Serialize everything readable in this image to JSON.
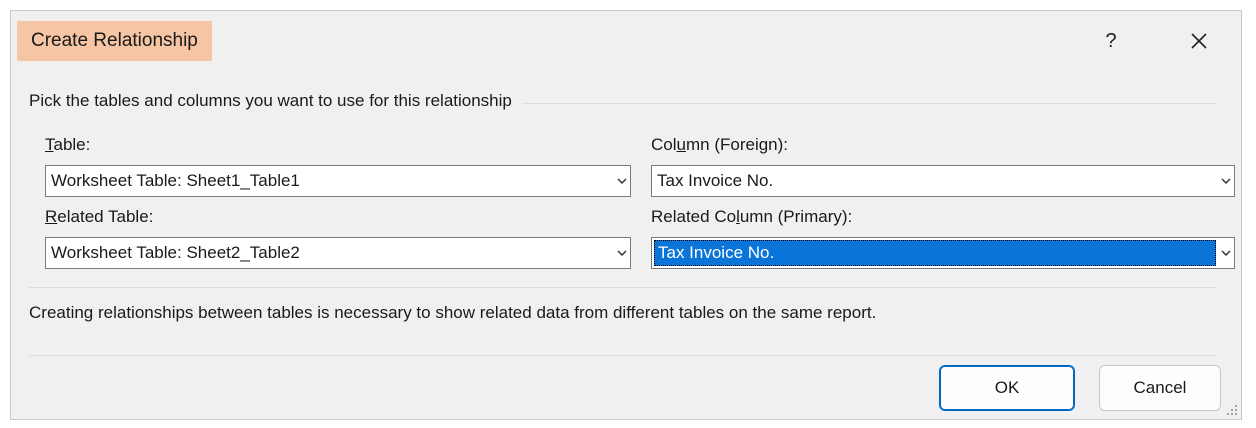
{
  "dialog": {
    "title": "Create Relationship",
    "help_label": "?",
    "close_icon": "close-icon"
  },
  "group": {
    "label": "Pick the tables and columns you want to use for this relationship"
  },
  "table": {
    "label_accel": "T",
    "label_rest": "able:",
    "value": "Worksheet Table: Sheet1_Table1"
  },
  "column_foreign": {
    "label_pre": "Col",
    "label_accel": "u",
    "label_rest": "mn (Foreign):",
    "value": "Tax Invoice No."
  },
  "related_table": {
    "label_accel": "R",
    "label_rest": "elated Table:",
    "value": "Worksheet Table: Sheet2_Table2"
  },
  "related_column": {
    "label_pre": "Related Co",
    "label_accel": "l",
    "label_rest": "umn (Primary):",
    "value": "Tax Invoice No."
  },
  "description": "Creating relationships between tables is necessary to show related data from different tables on the same report.",
  "buttons": {
    "ok": "OK",
    "cancel": "Cancel"
  },
  "colors": {
    "title_highlight": "#f6c5a3",
    "selection": "#0a74d8",
    "default_button_border": "#0067c0"
  }
}
